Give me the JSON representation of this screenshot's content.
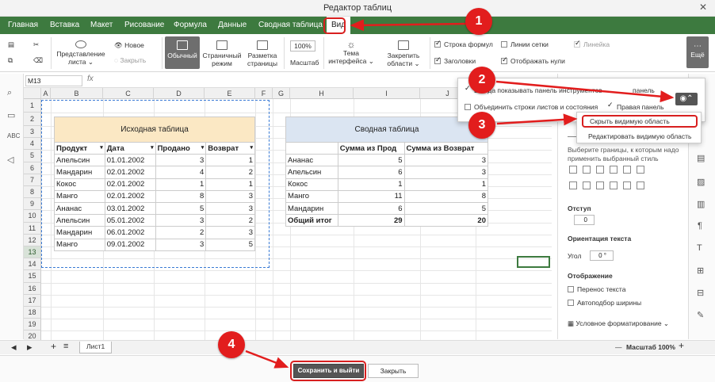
{
  "window": {
    "title": "Редактор таблиц",
    "close": "✕"
  },
  "tabs": [
    "Главная",
    "Вставка",
    "Макет",
    "Рисование",
    "Формула",
    "Данные",
    "Сводная таблица",
    "Вид"
  ],
  "ribbon": {
    "view_previews": "Представление листа ⌄",
    "new": "Новое",
    "close_view": "Закрыть",
    "normal": "Обычный",
    "page_mode": "Страничный режим",
    "page_layout": "Разметка страницы",
    "zoom_value": "100%",
    "zoom_label": "Масштаб",
    "theme": "Тема интерфейса ⌄",
    "freeze": "Закрепить области ⌄",
    "formula_bar": "Строка формул",
    "headings": "Заголовки",
    "gridlines": "Линии сетки",
    "show_zeros": "Отображать нули",
    "ruler": "Линейка",
    "more": "Ещё"
  },
  "formula": {
    "cell": "M13",
    "fx": "fx"
  },
  "columns": [
    "A",
    "B",
    "C",
    "D",
    "E",
    "F",
    "G",
    "H",
    "I",
    "J"
  ],
  "rows": [
    "1",
    "2",
    "3",
    "4",
    "5",
    "6",
    "7",
    "8",
    "9",
    "10",
    "11",
    "12",
    "13",
    "14",
    "15",
    "16",
    "17",
    "18",
    "19",
    "20"
  ],
  "source_table": {
    "title": "Исходная таблица",
    "headers": [
      "Продукт",
      "Дата",
      "Продано",
      "Возврат"
    ],
    "rows": [
      [
        "Апельсин",
        "01.01.2002",
        "3",
        "1"
      ],
      [
        "Мандарин",
        "02.01.2002",
        "4",
        "2"
      ],
      [
        "Кокос",
        "02.01.2002",
        "1",
        "1"
      ],
      [
        "Манго",
        "02.01.2002",
        "8",
        "3"
      ],
      [
        "Ананас",
        "03.01.2002",
        "5",
        "3"
      ],
      [
        "Апельсин",
        "05.01.2002",
        "3",
        "2"
      ],
      [
        "Мандарин",
        "06.01.2002",
        "2",
        "3"
      ],
      [
        "Манго",
        "09.01.2002",
        "3",
        "5"
      ]
    ]
  },
  "pivot_table": {
    "title": "Сводная таблица",
    "headers": [
      "",
      "Сумма из Прод",
      "Сумма из Возврат"
    ],
    "rows": [
      [
        "Ананас",
        "5",
        "3"
      ],
      [
        "Апельсин",
        "6",
        "3"
      ],
      [
        "Кокос",
        "1",
        "1"
      ],
      [
        "Манго",
        "11",
        "8"
      ],
      [
        "Мандарин",
        "6",
        "5"
      ]
    ],
    "total": [
      "Общий итог",
      "29",
      "20"
    ]
  },
  "popup": {
    "always_show_toolbar": "Всегда показывать панель инструментов",
    "merge_rows": "Объединить строки листов и состояния",
    "right_panel_1": "панель",
    "right_panel_2": "Правая панель"
  },
  "menu": {
    "hide": "Скрыть видимую область",
    "edit": "Редактировать видимую область"
  },
  "right_panel": {
    "borders_hint": "Выберите границы, к которым надо применить выбранный стиль",
    "indent": "Отступ",
    "indent_value": "0",
    "orientation": "Ориентация текста",
    "angle": "Угол",
    "angle_value": "0 °",
    "display": "Отображение",
    "wrap": "Перенос текста",
    "autofit": "Автоподбор ширины",
    "cond_format": "Условное форматирование ⌄"
  },
  "sheet": {
    "name": "Лист1",
    "zoom": "Масштаб 100%",
    "minus": "—",
    "plus": "+"
  },
  "buttons": {
    "save_exit": "Сохранить и выйти",
    "close": "Закрыть"
  },
  "badges": [
    "1",
    "2",
    "3",
    "4"
  ],
  "colors": {
    "accent": "#3d7a3f",
    "annotation": "#e21d1d"
  }
}
